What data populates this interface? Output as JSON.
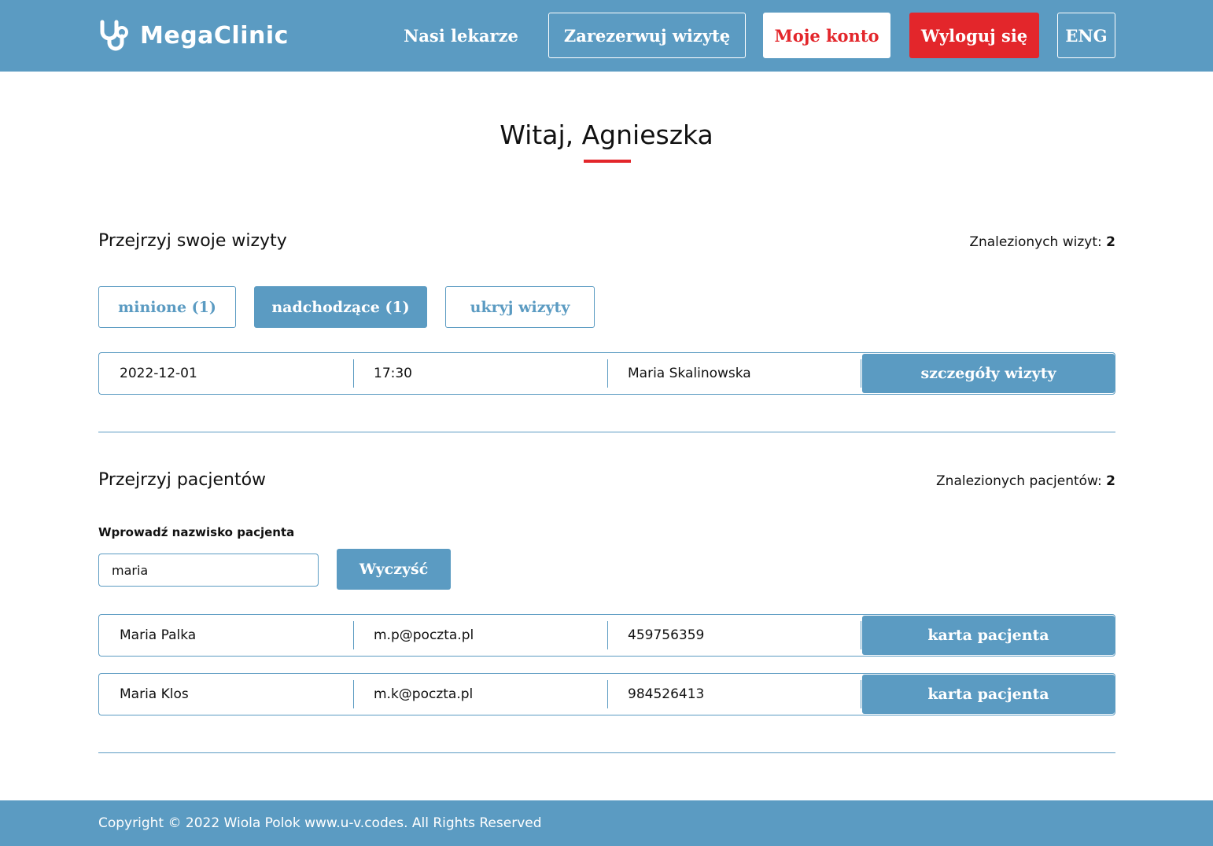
{
  "colors": {
    "brand_blue": "#5b9bc2",
    "accent_red": "#e3262b",
    "white": "#ffffff"
  },
  "header": {
    "logo_icon": "stethoscope-icon",
    "logo_text": "MegaClinic",
    "nav": {
      "doctors": "Nasi lekarze",
      "book": "Zarezerwuj wizytę",
      "account": "Moje konto",
      "logout": "Wyloguj się",
      "language": "ENG"
    }
  },
  "greeting": "Witaj, Agnieszka",
  "visits": {
    "title": "Przejrzyj swoje wizyty",
    "count_label": "Znalezionych wizyt:",
    "count": "2",
    "filters": {
      "past": "minione (1)",
      "upcoming": "nadchodzące (1)",
      "hide": "ukryj wizyty"
    },
    "rows": [
      {
        "date": "2022-12-01",
        "time": "17:30",
        "doctor": "Maria Skalinowska",
        "button": "szczegóły wizyty"
      }
    ]
  },
  "patients": {
    "title": "Przejrzyj pacjentów",
    "count_label": "Znalezionych pacjentów:",
    "count": "2",
    "search_label": "Wprowadź nazwisko pacjenta",
    "search_value": "maria",
    "clear_button": "Wyczyść",
    "rows": [
      {
        "name": "Maria Palka",
        "email": "m.p@poczta.pl",
        "phone": "459756359",
        "button": "karta pacjenta"
      },
      {
        "name": "Maria Klos",
        "email": "m.k@poczta.pl",
        "phone": "984526413",
        "button": "karta pacjenta"
      }
    ]
  },
  "footer": {
    "copyright": "Copyright © 2022 Wiola Polok www.u-v.codes. All Rights Reserved"
  }
}
